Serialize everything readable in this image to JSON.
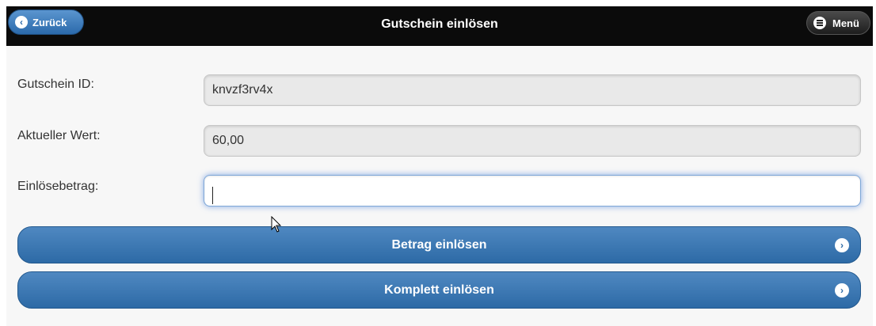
{
  "header": {
    "title": "Gutschein einlösen",
    "back_label": "Zurück",
    "menu_label": "Menü"
  },
  "form": {
    "id_label": "Gutschein ID:",
    "id_value": "knvzf3rv4x",
    "value_label": "Aktueller Wert:",
    "value_value": "60,00",
    "amount_label": "Einlösebetrag:",
    "amount_value": ""
  },
  "actions": {
    "redeem_amount": "Betrag einlösen",
    "redeem_full": "Komplett einlösen"
  },
  "colors": {
    "header_bg": "#0b0b0b",
    "button_blue": "#2d6aa6",
    "focus_glow": "#3875d7"
  },
  "icons": {
    "back": "chevron-left-icon",
    "menu": "hamburger-icon",
    "action": "chevron-right-icon"
  }
}
